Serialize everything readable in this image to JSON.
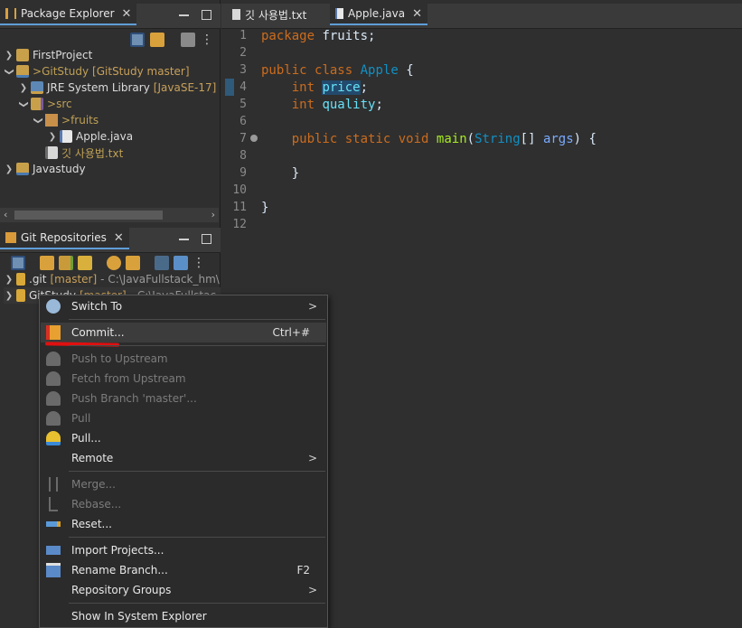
{
  "package_explorer": {
    "tab_label": "Package Explorer",
    "tree": [
      {
        "label": "FirstProject",
        "decoration": ""
      },
      {
        "label": "GitStudy",
        "decoration": "[GitStudy master]",
        "prefix": "> "
      },
      {
        "label": "JRE System Library",
        "decoration": "[JavaSE-17]"
      },
      {
        "label": "src",
        "decoration": "",
        "prefix": "> "
      },
      {
        "label": "fruits",
        "decoration": "",
        "prefix": "> "
      },
      {
        "label": "Apple.java",
        "decoration": ""
      },
      {
        "label": "깃 사용법.txt",
        "decoration": ""
      },
      {
        "label": "Javastudy",
        "decoration": ""
      }
    ]
  },
  "git_repositories": {
    "tab_label": "Git Repositories",
    "rows": [
      {
        "label": ".git",
        "branch": "[master]",
        "path": "- C:\\JavaFullstack_hm\\"
      },
      {
        "label": "GitStudy",
        "branch": "[master]",
        "path": "- C:\\JavaFullstac"
      }
    ]
  },
  "editor": {
    "tabs": [
      {
        "label": "깃 사용법.txt"
      },
      {
        "label": "Apple.java"
      }
    ],
    "line_numbers": [
      "1",
      "2",
      "3",
      "4",
      "5",
      "6",
      "7",
      "8",
      "9",
      "10",
      "11",
      "12"
    ],
    "code": {
      "l1_kw": "package",
      "l1_rest": " fruits;",
      "l3_kw1": "public",
      "l3_kw2": "class",
      "l3_cls": "Apple",
      "l3_rest": " {",
      "l4_kw": "int",
      "l4_fld": "price",
      "l4_rest": ";",
      "l5_kw": "int",
      "l5_fld": "quality",
      "l5_rest": ";",
      "l7_kw1": "public",
      "l7_kw2": "static",
      "l7_kw3": "void",
      "l7_mth": "main",
      "l7_p1": "(",
      "l7_cls": "String",
      "l7_p2": "[] ",
      "l7_var": "args",
      "l7_p3": ") {",
      "l9": "}",
      "l11": "}"
    }
  },
  "context_menu": {
    "items": [
      {
        "label": "Switch To",
        "submenu": ">",
        "enabled": true
      },
      {
        "label": "Commit...",
        "shortcut": "Ctrl+#",
        "enabled": true
      },
      {
        "label": "Push to Upstream",
        "enabled": false
      },
      {
        "label": "Fetch from Upstream",
        "enabled": false
      },
      {
        "label": "Push Branch 'master'...",
        "enabled": false
      },
      {
        "label": "Pull",
        "enabled": false
      },
      {
        "label": "Pull...",
        "enabled": true
      },
      {
        "label": "Remote",
        "submenu": ">",
        "enabled": true
      },
      {
        "label": "Merge...",
        "enabled": false
      },
      {
        "label": "Rebase...",
        "enabled": false
      },
      {
        "label": "Reset...",
        "enabled": true
      },
      {
        "label": "Import Projects...",
        "enabled": true
      },
      {
        "label": "Rename Branch...",
        "shortcut": "F2",
        "enabled": true
      },
      {
        "label": "Repository Groups",
        "submenu": ">",
        "enabled": true
      },
      {
        "label": "Show In System Explorer",
        "enabled": true
      }
    ]
  },
  "colors": {
    "background": "#2f2f2f",
    "keyword": "#cc6c1d",
    "class_name": "#1290c3",
    "field": "#66e1f8",
    "method": "#a7ec21",
    "annotation_underline": "#e01010"
  }
}
